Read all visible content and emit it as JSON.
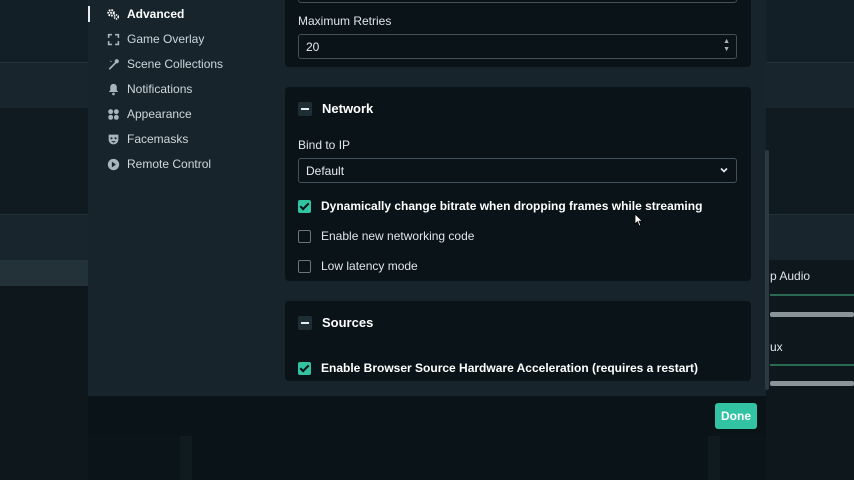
{
  "sidebar": {
    "items": [
      {
        "label": "Advanced",
        "icon": "gears-icon",
        "active": true
      },
      {
        "label": "Game Overlay",
        "icon": "expand-icon",
        "active": false
      },
      {
        "label": "Scene Collections",
        "icon": "tools-icon",
        "active": false
      },
      {
        "label": "Notifications",
        "icon": "bell-icon",
        "active": false
      },
      {
        "label": "Appearance",
        "icon": "palette-icon",
        "active": false
      },
      {
        "label": "Facemasks",
        "icon": "mask-icon",
        "active": false
      },
      {
        "label": "Remote Control",
        "icon": "play-circle-icon",
        "active": false
      }
    ]
  },
  "reconnect": {
    "max_retries_label": "Maximum Retries",
    "max_retries_value": "20"
  },
  "network": {
    "title": "Network",
    "bind_ip_label": "Bind to IP",
    "bind_ip_value": "Default",
    "options": [
      {
        "label": "Dynamically change bitrate when dropping frames while streaming",
        "checked": true
      },
      {
        "label": "Enable new networking code",
        "checked": false
      },
      {
        "label": "Low latency mode",
        "checked": false
      }
    ]
  },
  "sources": {
    "title": "Sources",
    "options": [
      {
        "label": "Enable Browser Source Hardware Acceleration (requires a restart)",
        "checked": true
      }
    ]
  },
  "footer": {
    "done_label": "Done"
  },
  "background": {
    "mixer_items": [
      "p Audio",
      "ux"
    ]
  },
  "colors": {
    "accent": "#31c3a2",
    "panel": "#0a1317",
    "modal": "#17242c"
  }
}
